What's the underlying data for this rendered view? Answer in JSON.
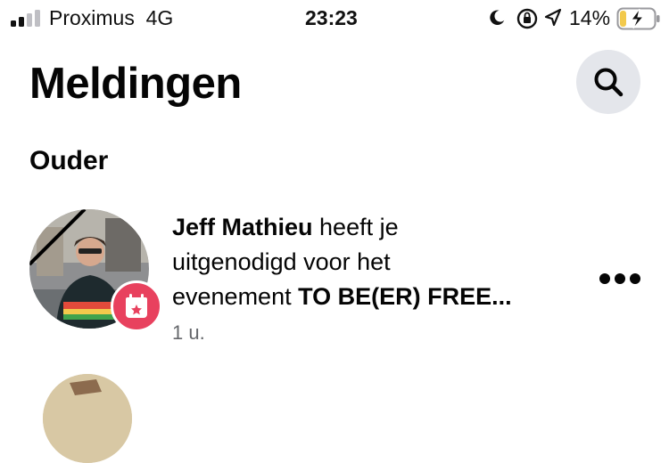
{
  "status_bar": {
    "carrier": "Proximus",
    "network": "4G",
    "time": "23:23",
    "battery_percent": "14%",
    "signal_bars_active": 2,
    "battery_level": 0.14
  },
  "header": {
    "title": "Meldingen",
    "search_icon": "search-icon"
  },
  "section_title": "Ouder",
  "notification": {
    "actor": "Jeff Mathieu",
    "text_1": " heeft je",
    "line_2": "uitgenodigd voor het",
    "text_3": "evenement ",
    "event": "TO BE(ER) FREE...",
    "time": "1 u.",
    "badge_icon": "event-calendar-icon",
    "more_icon": "more-dots-icon"
  },
  "colors": {
    "badge": "#e8415e",
    "search_bg": "#e4e6eb",
    "secondary_text": "#65676b",
    "battery_fill": "#f2c94c"
  }
}
